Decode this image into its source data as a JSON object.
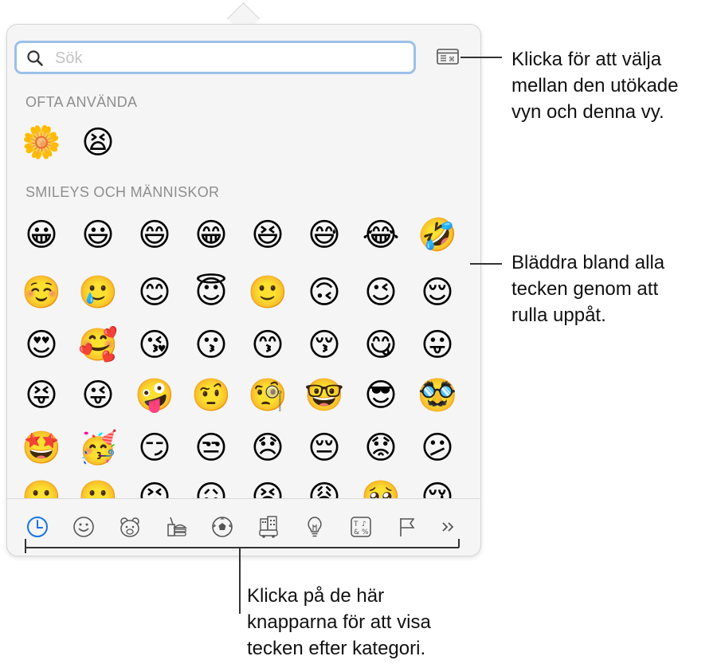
{
  "search": {
    "placeholder": "Sök"
  },
  "sections": {
    "frequently_used": {
      "title": "OFTA ANVÄNDA",
      "emojis": [
        "🌼",
        "😫"
      ]
    },
    "smileys": {
      "title": "SMILEYS OCH MÄNNISKOR",
      "rows": [
        [
          "😀",
          "😃",
          "😄",
          "😁",
          "😆",
          "😅",
          "😂",
          "🤣"
        ],
        [
          "☺️",
          "🥲",
          "😊",
          "😇",
          "🙂",
          "🙃",
          "😉",
          "😌"
        ],
        [
          "😍",
          "🥰",
          "😘",
          "😗",
          "😙",
          "😚",
          "😋",
          "😛"
        ],
        [
          "😝",
          "😜",
          "🤪",
          "🤨",
          "🧐",
          "🤓",
          "😎",
          "🥸"
        ],
        [
          "🤩",
          "🥳",
          "😏",
          "😒",
          "😞",
          "😔",
          "😟",
          "😕"
        ],
        [
          "🙁",
          "☹️",
          "😣",
          "😖",
          "😫",
          "😩",
          "🥺",
          "😢"
        ]
      ]
    }
  },
  "categories": [
    {
      "name": "Ofta använda",
      "icon": "clock-icon",
      "selected": true
    },
    {
      "name": "Smileys och människor",
      "icon": "smiley-icon"
    },
    {
      "name": "Djur och natur",
      "icon": "bear-icon"
    },
    {
      "name": "Mat och dryck",
      "icon": "food-icon"
    },
    {
      "name": "Aktivitet",
      "icon": "soccer-ball-icon"
    },
    {
      "name": "Resor och platser",
      "icon": "buildings-icon"
    },
    {
      "name": "Objekt",
      "icon": "lightbulb-icon"
    },
    {
      "name": "Symboler",
      "icon": "symbols-icon"
    },
    {
      "name": "Flaggor",
      "icon": "flag-icon"
    },
    {
      "name": "Fler",
      "icon": "chevron-double-right-icon"
    }
  ],
  "callouts": {
    "toggle": [
      "Klicka för att välja",
      "mellan den utökade",
      "vyn och denna vy."
    ],
    "scroll": [
      "Bläddra bland alla",
      "tecken genom att",
      "rulla uppåt."
    ],
    "categories": [
      "Klicka på de här",
      "knapparna för att visa",
      "tecken efter kategori."
    ]
  },
  "colors": {
    "accent": "#1a73e8",
    "search_focus_ring": "#9cc0ea",
    "section_title": "#8e8e8e"
  }
}
